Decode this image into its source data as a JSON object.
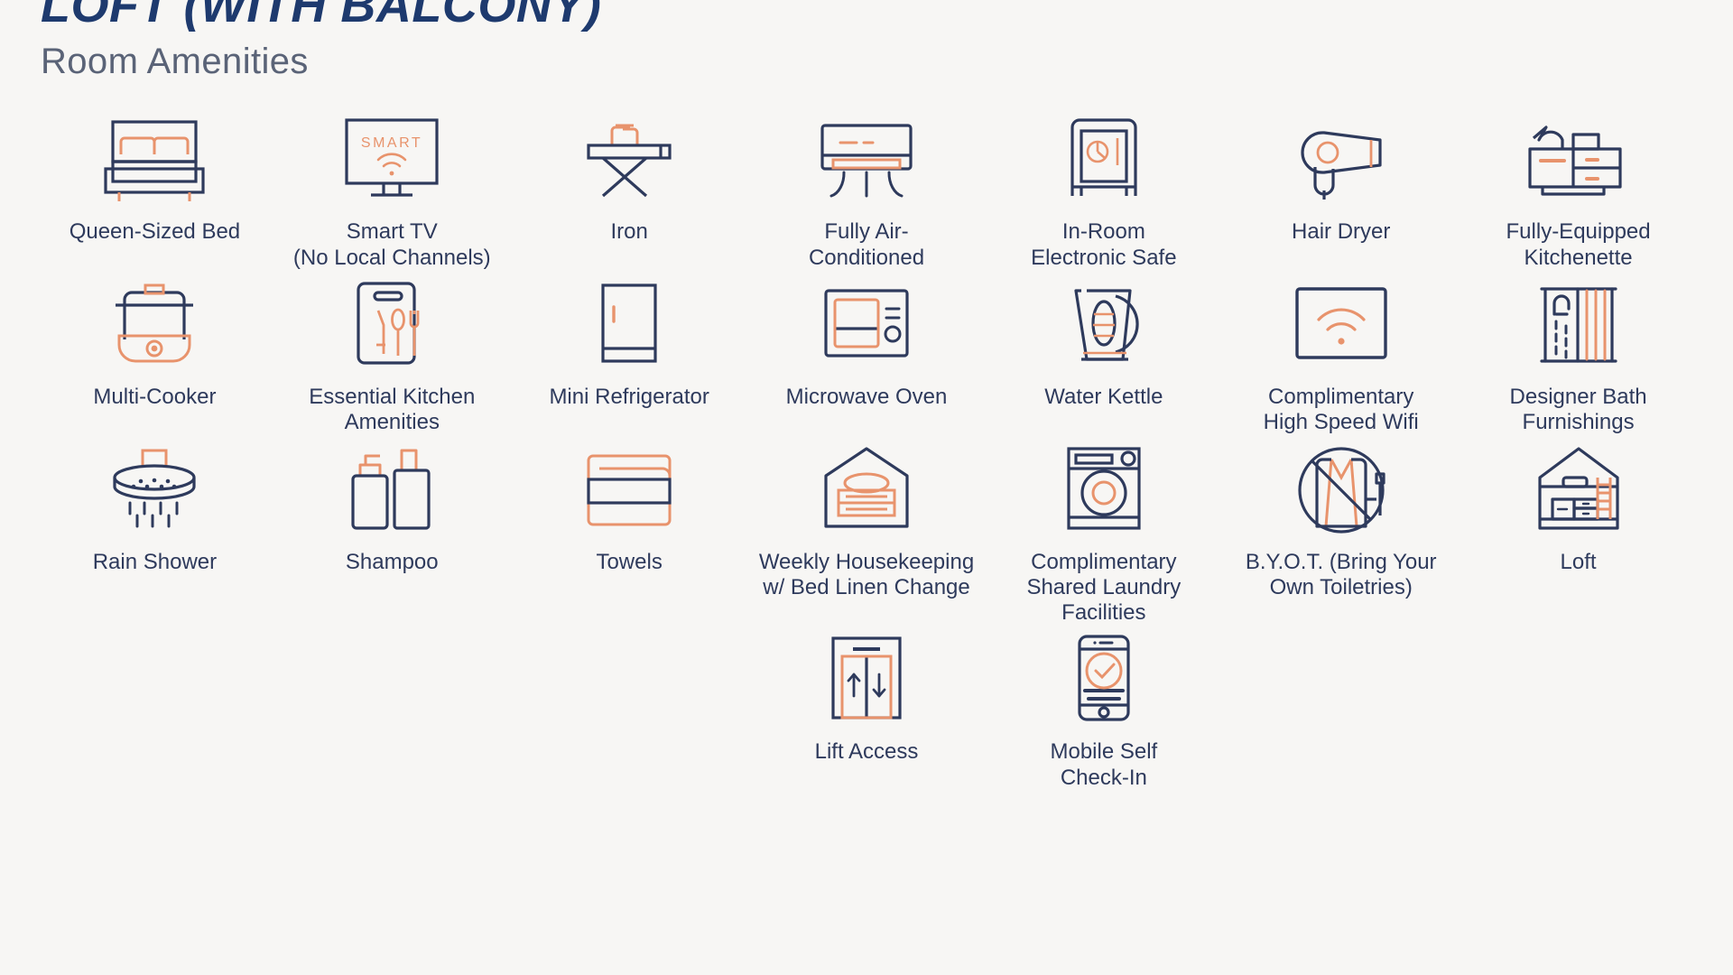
{
  "header": {
    "room_title": "LOFT (WITH BALCONY)",
    "section_title": "Room Amenities"
  },
  "colors": {
    "background": "#f7f6f4",
    "navy": "#2e3a5c",
    "title_navy": "#1e3a6e",
    "coral": "#e8936c",
    "subtitle_gray": "#5a6377"
  },
  "amenities": [
    {
      "icon": "bed-icon",
      "label": "Queen-Sized Bed"
    },
    {
      "icon": "smart-tv-icon",
      "label": "Smart TV\n(No Local Channels)"
    },
    {
      "icon": "iron-icon",
      "label": "Iron"
    },
    {
      "icon": "air-conditioner-icon",
      "label": "Fully Air-\nConditioned"
    },
    {
      "icon": "safe-icon",
      "label": "In-Room\nElectronic Safe"
    },
    {
      "icon": "hair-dryer-icon",
      "label": "Hair Dryer"
    },
    {
      "icon": "kitchenette-icon",
      "label": "Fully-Equipped\nKitchenette"
    },
    {
      "icon": "multi-cooker-icon",
      "label": "Multi-Cooker"
    },
    {
      "icon": "kitchen-utensils-icon",
      "label": "Essential Kitchen\nAmenities"
    },
    {
      "icon": "refrigerator-icon",
      "label": "Mini Refrigerator"
    },
    {
      "icon": "microwave-icon",
      "label": "Microwave Oven"
    },
    {
      "icon": "kettle-icon",
      "label": "Water Kettle"
    },
    {
      "icon": "wifi-router-icon",
      "label": "Complimentary\nHigh Speed Wifi"
    },
    {
      "icon": "shower-curtain-icon",
      "label": "Designer Bath\nFurnishings"
    },
    {
      "icon": "rain-shower-icon",
      "label": "Rain Shower"
    },
    {
      "icon": "shampoo-icon",
      "label": "Shampoo"
    },
    {
      "icon": "towels-icon",
      "label": "Towels"
    },
    {
      "icon": "housekeeping-icon",
      "label": "Weekly Housekeeping\nw/ Bed Linen Change"
    },
    {
      "icon": "washing-machine-icon",
      "label": "Complimentary\nShared Laundry\nFacilities"
    },
    {
      "icon": "no-toiletries-icon",
      "label": "B.Y.O.T. (Bring Your\nOwn Toiletries)"
    },
    {
      "icon": "loft-house-icon",
      "label": "Loft"
    },
    {
      "icon": "lift-icon",
      "label": "Lift Access"
    },
    {
      "icon": "mobile-checkin-icon",
      "label": "Mobile Self\nCheck-In"
    }
  ]
}
